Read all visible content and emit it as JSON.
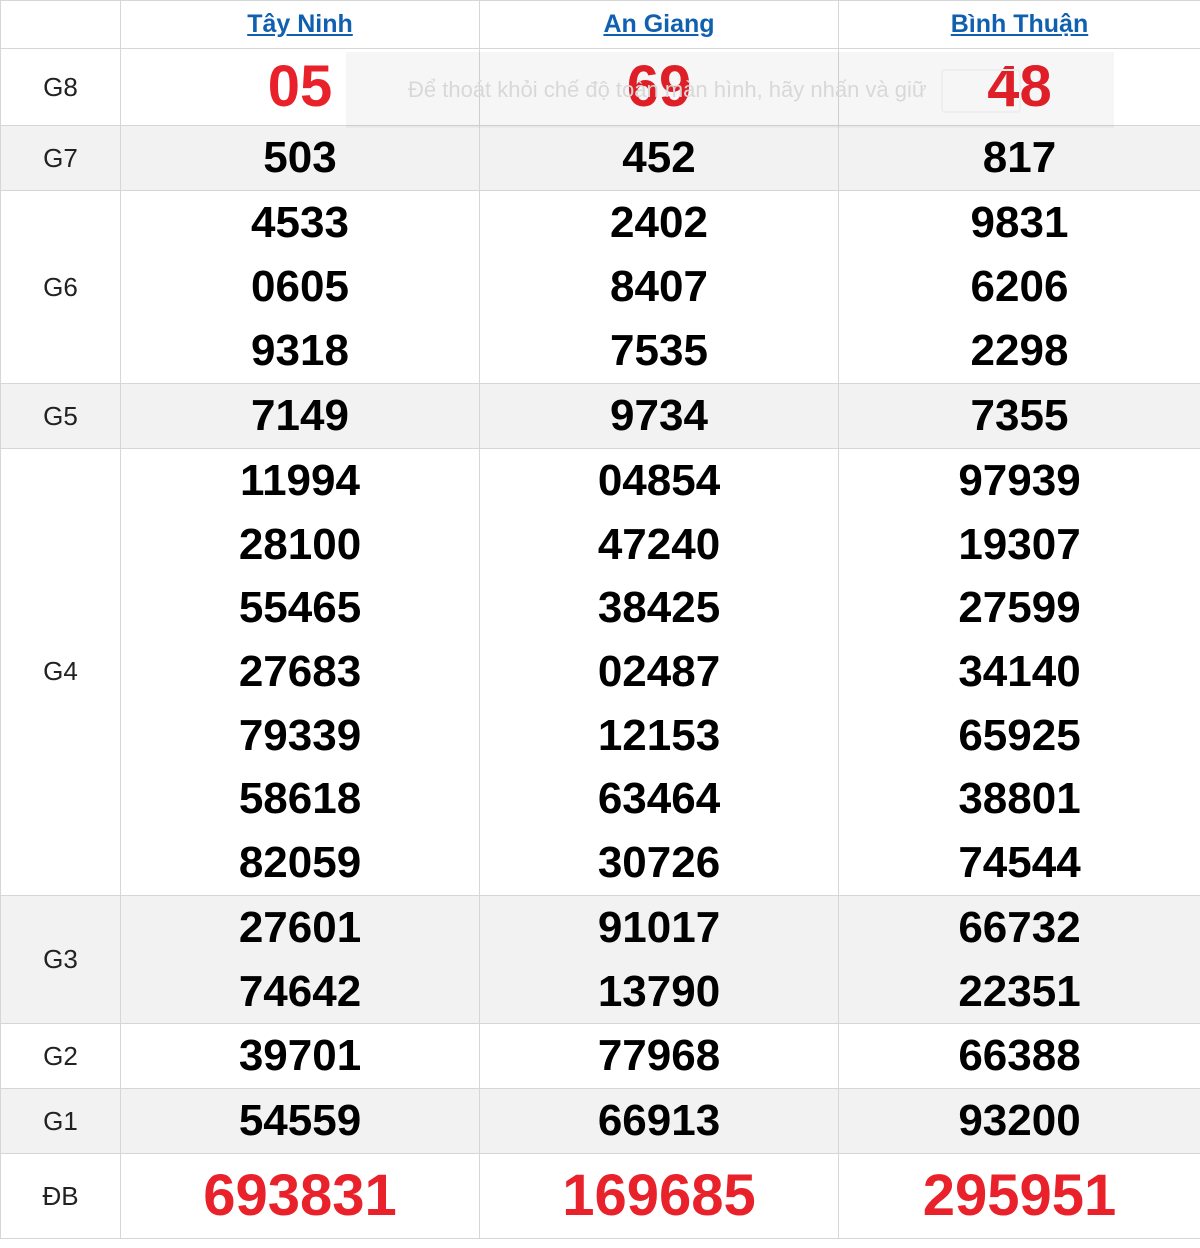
{
  "header": {
    "provinces": [
      "Tây Ninh",
      "An Giang",
      "Bình Thuận"
    ]
  },
  "rows": [
    {
      "label": "G8",
      "values": [
        [
          "05"
        ],
        [
          "69"
        ],
        [
          "48"
        ]
      ]
    },
    {
      "label": "G7",
      "values": [
        [
          "503"
        ],
        [
          "452"
        ],
        [
          "817"
        ]
      ]
    },
    {
      "label": "G6",
      "values": [
        [
          "4533",
          "0605",
          "9318"
        ],
        [
          "2402",
          "8407",
          "7535"
        ],
        [
          "9831",
          "6206",
          "2298"
        ]
      ]
    },
    {
      "label": "G5",
      "values": [
        [
          "7149"
        ],
        [
          "9734"
        ],
        [
          "7355"
        ]
      ]
    },
    {
      "label": "G4",
      "values": [
        [
          "11994",
          "28100",
          "55465",
          "27683",
          "79339",
          "58618",
          "82059"
        ],
        [
          "04854",
          "47240",
          "38425",
          "02487",
          "12153",
          "63464",
          "30726"
        ],
        [
          "97939",
          "19307",
          "27599",
          "34140",
          "65925",
          "38801",
          "74544"
        ]
      ]
    },
    {
      "label": "G3",
      "values": [
        [
          "27601",
          "74642"
        ],
        [
          "91017",
          "13790"
        ],
        [
          "66732",
          "22351"
        ]
      ]
    },
    {
      "label": "G2",
      "values": [
        [
          "39701"
        ],
        [
          "77968"
        ],
        [
          "66388"
        ]
      ]
    },
    {
      "label": "G1",
      "values": [
        [
          "54559"
        ],
        [
          "66913"
        ],
        [
          "93200"
        ]
      ]
    },
    {
      "label": "ĐB",
      "values": [
        [
          "693831"
        ],
        [
          "169685"
        ],
        [
          "295951"
        ]
      ]
    }
  ],
  "overlay_text": "Để thoát khỏi chế độ toàn màn hình, hãy nhấn và giữ",
  "colors": {
    "highlight": "#e8212a",
    "link": "#1060b0",
    "shade": "#f2f2f2"
  }
}
